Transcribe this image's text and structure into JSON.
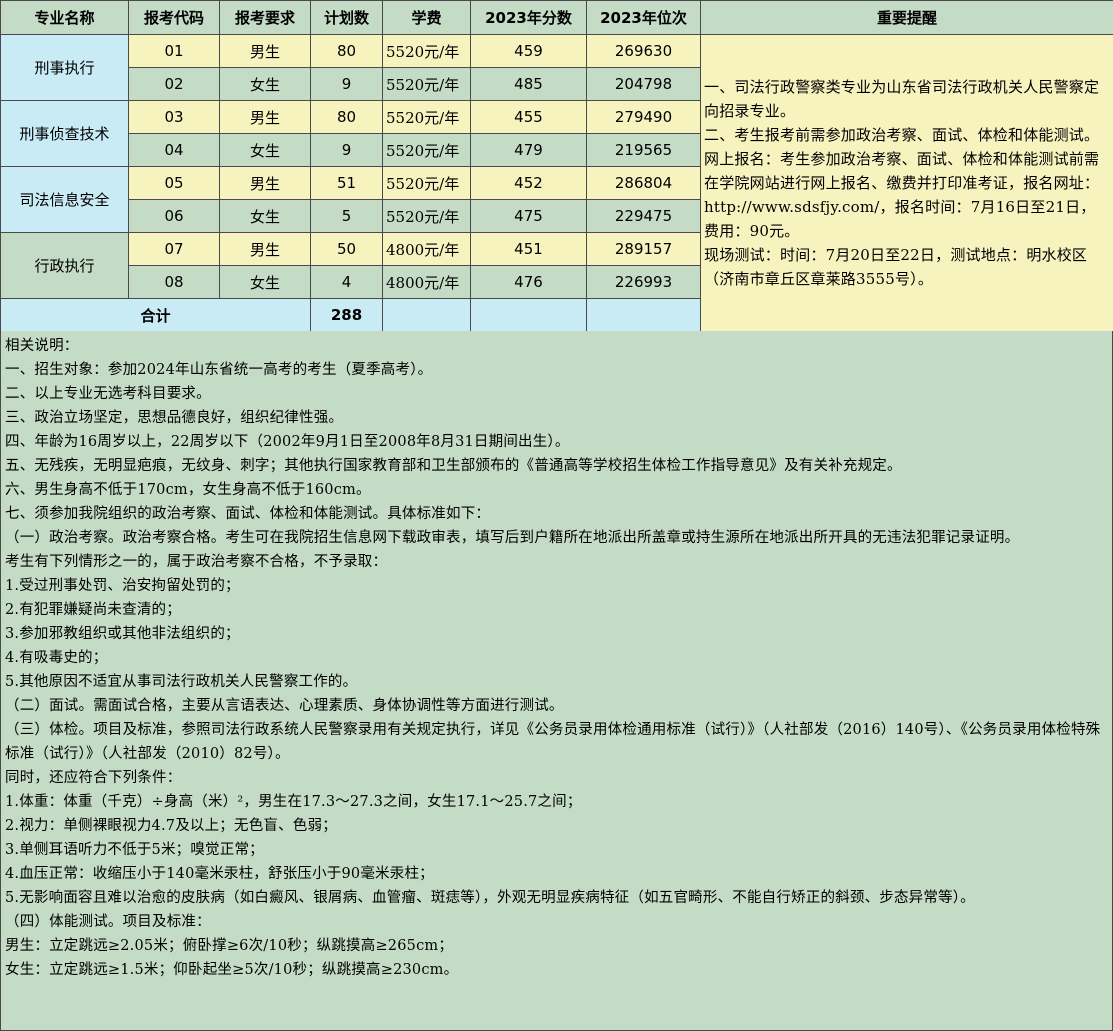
{
  "headers": [
    "专业名称",
    "报考代码",
    "报考要求",
    "计划数",
    "学费",
    "2023年分数",
    "2023年位次",
    "重要提醒"
  ],
  "majors": [
    {
      "name": "刑事执行",
      "rows": [
        {
          "code": "01",
          "req": "男生",
          "plan": "80",
          "fee": "5520元/年",
          "score": "459",
          "rank": "269630"
        },
        {
          "code": "02",
          "req": "女生",
          "plan": "9",
          "fee": "5520元/年",
          "score": "485",
          "rank": "204798"
        }
      ]
    },
    {
      "name": "刑事侦查技术",
      "rows": [
        {
          "code": "03",
          "req": "男生",
          "plan": "80",
          "fee": "5520元/年",
          "score": "455",
          "rank": "279490"
        },
        {
          "code": "04",
          "req": "女生",
          "plan": "9",
          "fee": "5520元/年",
          "score": "479",
          "rank": "219565"
        }
      ]
    },
    {
      "name": "司法信息安全",
      "rows": [
        {
          "code": "05",
          "req": "男生",
          "plan": "51",
          "fee": "5520元/年",
          "score": "452",
          "rank": "286804"
        },
        {
          "code": "06",
          "req": "女生",
          "plan": "5",
          "fee": "5520元/年",
          "score": "475",
          "rank": "229475"
        }
      ]
    },
    {
      "name": "行政执行",
      "rows": [
        {
          "code": "07",
          "req": "男生",
          "plan": "50",
          "fee": "4800元/年",
          "score": "451",
          "rank": "289157"
        },
        {
          "code": "08",
          "req": "女生",
          "plan": "4",
          "fee": "4800元/年",
          "score": "476",
          "rank": "226993"
        }
      ]
    }
  ],
  "total": {
    "label": "合计",
    "value": "288"
  },
  "reminder": [
    "一、司法行政警察类专业为山东省司法行政机关人民警察定向招录专业。",
    "二、考生报考前需参加政治考察、面试、体检和体能测试。",
    "网上报名：考生参加政治考察、面试、体检和体能测试前需在学院网站进行网上报名、缴费并打印准考证，报名网址：http://www.sdsfjy.com/，报名时间：7月16日至21日，费用：90元。",
    "现场测试：时间：7月20日至22日，测试地点：明水校区（济南市章丘区章莱路3555号）。"
  ],
  "notes": [
    "相关说明：",
    "一、招生对象：参加2024年山东省统一高考的考生（夏季高考）。",
    "二、以上专业无选考科目要求。",
    "三、政治立场坚定，思想品德良好，组织纪律性强。",
    "四、年龄为16周岁以上，22周岁以下（2002年9月1日至2008年8月31日期间出生）。",
    "五、无残疾，无明显疤痕，无纹身、刺字；其他执行国家教育部和卫生部颁布的《普通高等学校招生体检工作指导意见》及有关补充规定。",
    "六、男生身高不低于170cm，女生身高不低于160cm。",
    "七、须参加我院组织的政治考察、面试、体检和体能测试。具体标准如下：",
    "（一）政治考察。政治考察合格。考生可在我院招生信息网下载政审表，填写后到户籍所在地派出所盖章或持生源所在地派出所开具的无违法犯罪记录证明。",
    "考生有下列情形之一的，属于政治考察不合格，不予录取：",
    "1.受过刑事处罚、治安拘留处罚的；",
    "2.有犯罪嫌疑尚未查清的；",
    "3.参加邪教组织或其他非法组织的；",
    "4.有吸毒史的；",
    "5.其他原因不适宜从事司法行政机关人民警察工作的。",
    "（二）面试。需面试合格，主要从言语表达、心理素质、身体协调性等方面进行测试。",
    "（三）体检。项目及标准，参照司法行政系统人民警察录用有关规定执行，详见《公务员录用体检通用标准（试行）》（人社部发（2016）140号）、《公务员录用体检特殊标准（试行）》（人社部发（2010）82号）。",
    "同时，还应符合下列条件：",
    "1.体重：体重（千克）÷身高（米）²，男生在17.3～27.3之间，女生17.1～25.7之间；",
    "2.视力：单侧裸眼视力4.7及以上；无色盲、色弱；",
    "3.单侧耳语听力不低于5米；嗅觉正常；",
    "4.血压正常：收缩压小于140毫米汞柱，舒张压小于90毫米汞柱；",
    "5.无影响面容且难以治愈的皮肤病（如白癜风、银屑病、血管瘤、斑痣等），外观无明显疾病特征（如五官畸形、不能自行矫正的斜颈、步态异常等）。",
    "（四）体能测试。项目及标准：",
    "男生：立定跳远≥2.05米；俯卧撑≥6次/10秒；纵跳摸高≥265cm；",
    "女生：立定跳远≥1.5米；仰卧起坐≥5次/10秒；纵跳摸高≥230cm。"
  ]
}
